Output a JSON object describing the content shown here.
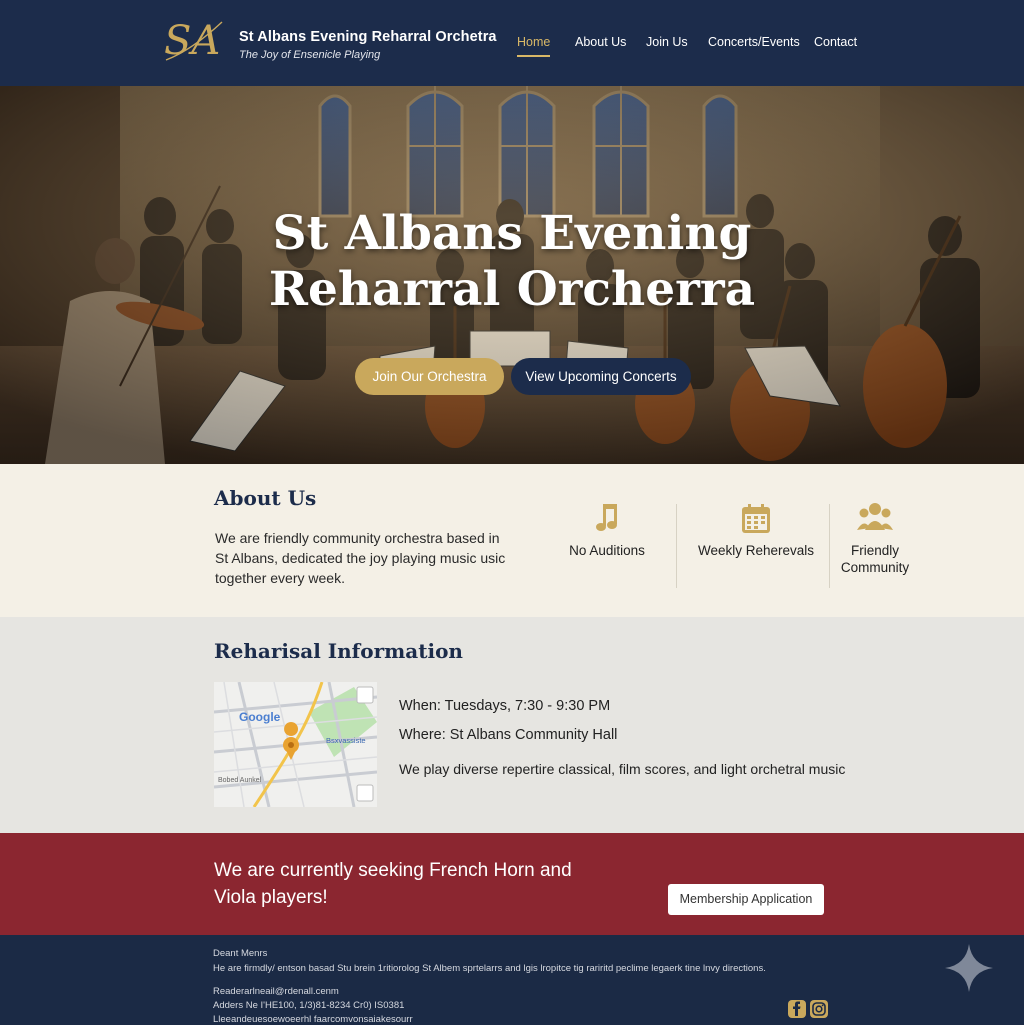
{
  "header": {
    "logo_text": "SA",
    "title": "St Albans Evening Reharral Orchetra",
    "tagline": "The Joy of Ensenicle Playing",
    "nav": [
      {
        "label": "Home",
        "active": true
      },
      {
        "label": "About Us"
      },
      {
        "label": "Join Us"
      },
      {
        "label": "Concerts/Events"
      },
      {
        "label": "Contact"
      }
    ]
  },
  "hero": {
    "title_line1": "St Albans Evening",
    "title_line2": "Reharral Orcherra",
    "primary_button": "Join Our Orchestra",
    "secondary_button": "View Upcoming Concerts"
  },
  "about": {
    "heading": "About Us",
    "text": "We are friendly community orchestra based in St Albans, dedicated the joy playing music usic together every week.",
    "features": [
      {
        "icon": "music-note-icon",
        "label": "No Auditions"
      },
      {
        "icon": "calendar-icon",
        "label": "Weekly Reherevals"
      },
      {
        "icon": "community-icon",
        "label": "Friendly Community"
      }
    ]
  },
  "rehearsal": {
    "heading": "Reharisal Information",
    "map": {
      "brand": "Google",
      "street_label": "Bsxvassiste",
      "area_label": "Bobed Aunkel"
    },
    "when": "When: Tuesdays, 7:30 - 9:30 PM",
    "where": "Where: St Albans Community Hall",
    "repertoire": "We play diverse repertire classical, film scores, and light orchetral music"
  },
  "cta": {
    "text": "We are currently seeking French Horn and Viola players!",
    "button": "Membership Application"
  },
  "footer": {
    "heading": "Deant Menrs",
    "line1": "He are firmdly/ entson basad  Stu brein 1ritiorolog St Albem sprtelarrs and lgis lropitce tig rariritd peclime legaerk tine lnvy directions.",
    "email": "Readerarlneail@rdenall.cenm",
    "phone": "Adders Ne I'HE100, 1/3)81-8234 Cr0) IS0381",
    "line4": "Lleeandeuesoewoeerhl faarcomvonsaiakesourr",
    "social": [
      "facebook-icon",
      "instagram-icon"
    ]
  },
  "colors": {
    "navy": "#1c2c4b",
    "gold": "#c9a85c",
    "cream": "#f4f0e6",
    "maroon": "#8b2630"
  }
}
